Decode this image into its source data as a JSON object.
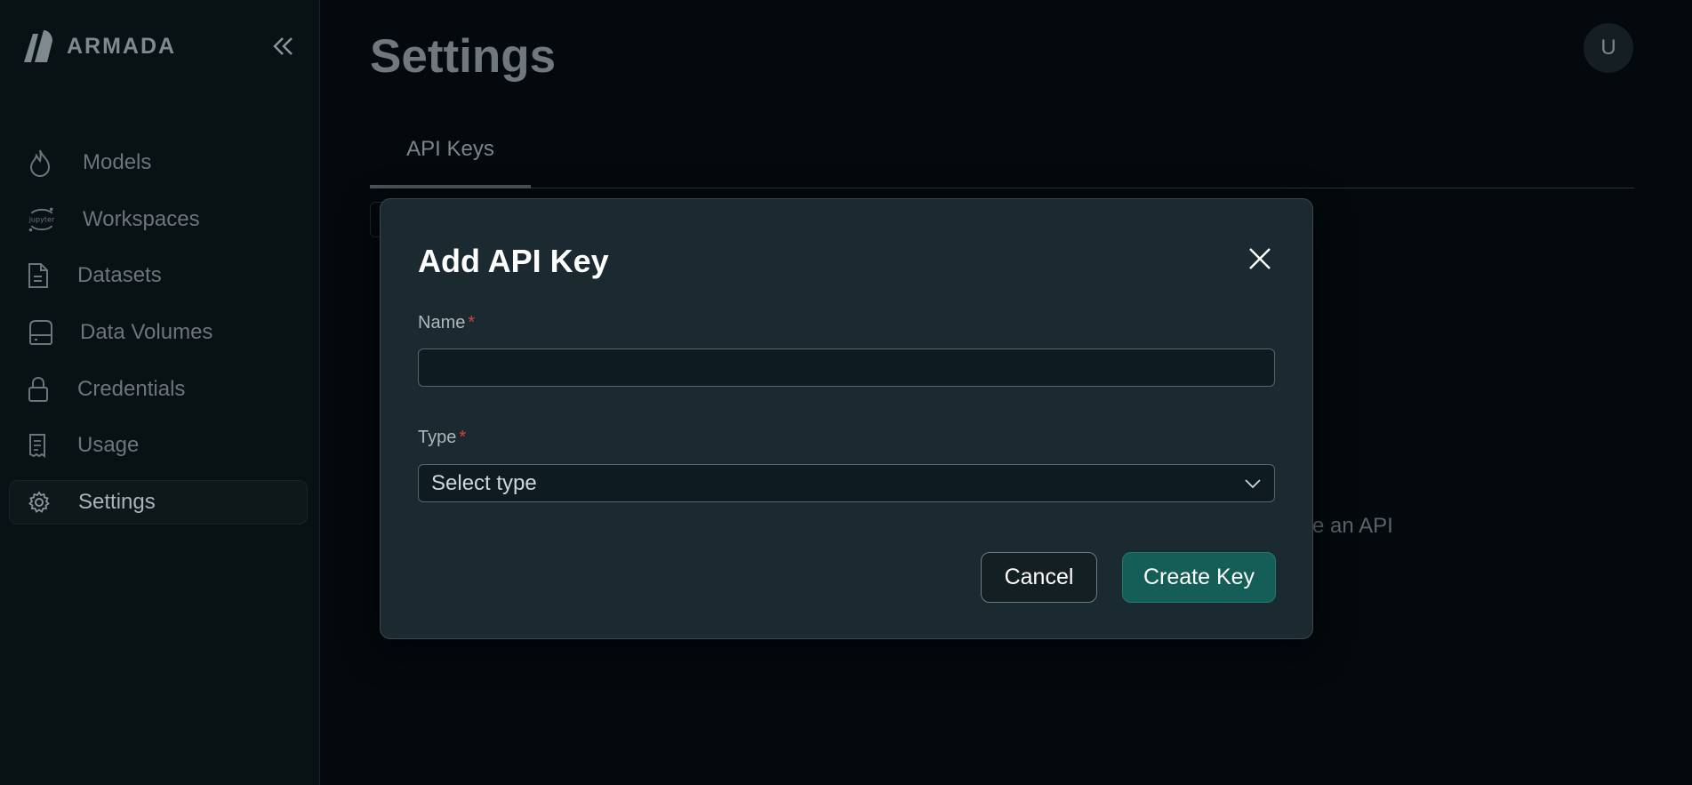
{
  "app": {
    "brand": "ARMADA"
  },
  "sidebar": {
    "items": [
      {
        "label": "Models",
        "icon": "flame-icon"
      },
      {
        "label": "Workspaces",
        "icon": "jupyter-icon"
      },
      {
        "label": "Datasets",
        "icon": "document-icon"
      },
      {
        "label": "Data Volumes",
        "icon": "drive-icon"
      },
      {
        "label": "Credentials",
        "icon": "lock-icon"
      },
      {
        "label": "Usage",
        "icon": "receipt-icon"
      },
      {
        "label": "Settings",
        "icon": "gear-icon",
        "active": true
      }
    ],
    "jupyter_text": "jupyter"
  },
  "main": {
    "title": "Settings",
    "avatar_initial": "U",
    "tabs": [
      {
        "label": "API Keys",
        "active": true
      }
    ],
    "background_text": "ate an API"
  },
  "modal": {
    "title": "Add API Key",
    "name_label": "Name",
    "name_value": "",
    "type_label": "Type",
    "required_marker": "*",
    "type_value": "Select type",
    "cancel_label": "Cancel",
    "create_label": "Create Key"
  },
  "colors": {
    "accent": "#155e57",
    "required": "#d9413a",
    "background": "#03090c",
    "modal": "#1b2930"
  }
}
